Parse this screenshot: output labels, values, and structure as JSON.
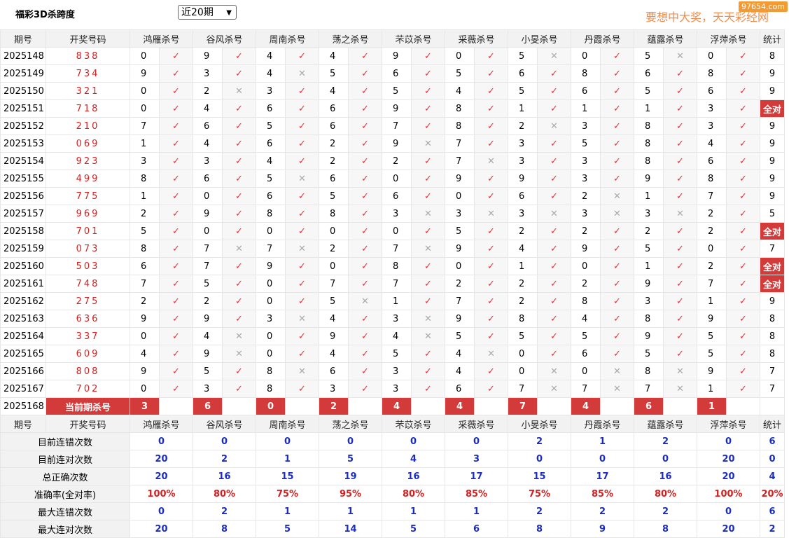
{
  "header": {
    "title": "福彩3D杀跨度",
    "period_select": "近20期",
    "slogan": "要想中大奖，天天彩经网",
    "watermark": "97654.com"
  },
  "columns": {
    "issue": "期号",
    "draw": "开奖号码",
    "experts": [
      "鸿雁杀号",
      "谷风杀号",
      "周南杀号",
      "荡之杀号",
      "芣苡杀号",
      "采薇杀号",
      "小旻杀号",
      "丹霞杀号",
      "蕴露杀号",
      "浮萍杀号"
    ],
    "stat": "统计"
  },
  "marks": {
    "ok": "✓",
    "no": "✕"
  },
  "rows": [
    {
      "issue": "2025148",
      "draw": "838",
      "picks": [
        [
          0,
          1
        ],
        [
          9,
          1
        ],
        [
          4,
          1
        ],
        [
          4,
          1
        ],
        [
          9,
          1
        ],
        [
          0,
          1
        ],
        [
          5,
          0
        ],
        [
          0,
          1
        ],
        [
          5,
          0
        ],
        [
          0,
          1
        ]
      ],
      "stat": "8"
    },
    {
      "issue": "2025149",
      "draw": "734",
      "picks": [
        [
          9,
          1
        ],
        [
          3,
          1
        ],
        [
          4,
          0
        ],
        [
          5,
          1
        ],
        [
          6,
          1
        ],
        [
          5,
          1
        ],
        [
          6,
          1
        ],
        [
          8,
          1
        ],
        [
          6,
          1
        ],
        [
          8,
          1
        ]
      ],
      "stat": "9"
    },
    {
      "issue": "2025150",
      "draw": "321",
      "picks": [
        [
          0,
          1
        ],
        [
          2,
          0
        ],
        [
          3,
          1
        ],
        [
          4,
          1
        ],
        [
          5,
          1
        ],
        [
          4,
          1
        ],
        [
          5,
          1
        ],
        [
          6,
          1
        ],
        [
          5,
          1
        ],
        [
          6,
          1
        ]
      ],
      "stat": "9"
    },
    {
      "issue": "2025151",
      "draw": "718",
      "picks": [
        [
          0,
          1
        ],
        [
          4,
          1
        ],
        [
          6,
          1
        ],
        [
          6,
          1
        ],
        [
          9,
          1
        ],
        [
          8,
          1
        ],
        [
          1,
          1
        ],
        [
          1,
          1
        ],
        [
          1,
          1
        ],
        [
          3,
          1
        ]
      ],
      "stat": "全对"
    },
    {
      "issue": "2025152",
      "draw": "210",
      "picks": [
        [
          7,
          1
        ],
        [
          6,
          1
        ],
        [
          5,
          1
        ],
        [
          6,
          1
        ],
        [
          7,
          1
        ],
        [
          8,
          1
        ],
        [
          2,
          0
        ],
        [
          3,
          1
        ],
        [
          8,
          1
        ],
        [
          3,
          1
        ]
      ],
      "stat": "9"
    },
    {
      "issue": "2025153",
      "draw": "069",
      "picks": [
        [
          1,
          1
        ],
        [
          4,
          1
        ],
        [
          6,
          1
        ],
        [
          2,
          1
        ],
        [
          9,
          0
        ],
        [
          7,
          1
        ],
        [
          3,
          1
        ],
        [
          5,
          1
        ],
        [
          8,
          1
        ],
        [
          4,
          1
        ]
      ],
      "stat": "9"
    },
    {
      "issue": "2025154",
      "draw": "923",
      "picks": [
        [
          3,
          1
        ],
        [
          3,
          1
        ],
        [
          4,
          1
        ],
        [
          2,
          1
        ],
        [
          2,
          1
        ],
        [
          7,
          0
        ],
        [
          3,
          1
        ],
        [
          3,
          1
        ],
        [
          8,
          1
        ],
        [
          6,
          1
        ]
      ],
      "stat": "9"
    },
    {
      "issue": "2025155",
      "draw": "499",
      "picks": [
        [
          8,
          1
        ],
        [
          6,
          1
        ],
        [
          5,
          0
        ],
        [
          6,
          1
        ],
        [
          0,
          1
        ],
        [
          9,
          1
        ],
        [
          9,
          1
        ],
        [
          3,
          1
        ],
        [
          9,
          1
        ],
        [
          8,
          1
        ]
      ],
      "stat": "9"
    },
    {
      "issue": "2025156",
      "draw": "775",
      "picks": [
        [
          1,
          1
        ],
        [
          0,
          1
        ],
        [
          6,
          1
        ],
        [
          5,
          1
        ],
        [
          6,
          1
        ],
        [
          0,
          1
        ],
        [
          6,
          1
        ],
        [
          2,
          0
        ],
        [
          1,
          1
        ],
        [
          7,
          1
        ]
      ],
      "stat": "9"
    },
    {
      "issue": "2025157",
      "draw": "969",
      "picks": [
        [
          2,
          1
        ],
        [
          9,
          1
        ],
        [
          8,
          1
        ],
        [
          8,
          1
        ],
        [
          3,
          0
        ],
        [
          3,
          0
        ],
        [
          3,
          0
        ],
        [
          3,
          0
        ],
        [
          3,
          0
        ],
        [
          2,
          1
        ]
      ],
      "stat": "5"
    },
    {
      "issue": "2025158",
      "draw": "701",
      "picks": [
        [
          5,
          1
        ],
        [
          0,
          1
        ],
        [
          0,
          1
        ],
        [
          0,
          1
        ],
        [
          0,
          1
        ],
        [
          5,
          1
        ],
        [
          2,
          1
        ],
        [
          2,
          1
        ],
        [
          2,
          1
        ],
        [
          2,
          1
        ]
      ],
      "stat": "全对"
    },
    {
      "issue": "2025159",
      "draw": "073",
      "picks": [
        [
          8,
          1
        ],
        [
          7,
          0
        ],
        [
          7,
          0
        ],
        [
          2,
          1
        ],
        [
          7,
          0
        ],
        [
          9,
          1
        ],
        [
          4,
          1
        ],
        [
          9,
          1
        ],
        [
          5,
          1
        ],
        [
          0,
          1
        ]
      ],
      "stat": "7"
    },
    {
      "issue": "2025160",
      "draw": "503",
      "picks": [
        [
          6,
          1
        ],
        [
          7,
          1
        ],
        [
          9,
          1
        ],
        [
          0,
          1
        ],
        [
          8,
          1
        ],
        [
          0,
          1
        ],
        [
          1,
          1
        ],
        [
          0,
          1
        ],
        [
          1,
          1
        ],
        [
          2,
          1
        ]
      ],
      "stat": "全对"
    },
    {
      "issue": "2025161",
      "draw": "748",
      "picks": [
        [
          7,
          1
        ],
        [
          5,
          1
        ],
        [
          0,
          1
        ],
        [
          7,
          1
        ],
        [
          7,
          1
        ],
        [
          2,
          1
        ],
        [
          2,
          1
        ],
        [
          2,
          1
        ],
        [
          9,
          1
        ],
        [
          7,
          1
        ]
      ],
      "stat": "全对"
    },
    {
      "issue": "2025162",
      "draw": "275",
      "picks": [
        [
          2,
          1
        ],
        [
          2,
          1
        ],
        [
          0,
          1
        ],
        [
          5,
          0
        ],
        [
          1,
          1
        ],
        [
          7,
          1
        ],
        [
          2,
          1
        ],
        [
          8,
          1
        ],
        [
          3,
          1
        ],
        [
          1,
          1
        ]
      ],
      "stat": "9"
    },
    {
      "issue": "2025163",
      "draw": "636",
      "picks": [
        [
          9,
          1
        ],
        [
          9,
          1
        ],
        [
          3,
          0
        ],
        [
          4,
          1
        ],
        [
          3,
          0
        ],
        [
          9,
          1
        ],
        [
          8,
          1
        ],
        [
          4,
          1
        ],
        [
          8,
          1
        ],
        [
          9,
          1
        ]
      ],
      "stat": "8"
    },
    {
      "issue": "2025164",
      "draw": "337",
      "picks": [
        [
          0,
          1
        ],
        [
          4,
          0
        ],
        [
          0,
          1
        ],
        [
          9,
          1
        ],
        [
          4,
          0
        ],
        [
          5,
          1
        ],
        [
          5,
          1
        ],
        [
          5,
          1
        ],
        [
          9,
          1
        ],
        [
          5,
          1
        ]
      ],
      "stat": "8"
    },
    {
      "issue": "2025165",
      "draw": "609",
      "picks": [
        [
          4,
          1
        ],
        [
          9,
          0
        ],
        [
          0,
          1
        ],
        [
          4,
          1
        ],
        [
          5,
          1
        ],
        [
          4,
          0
        ],
        [
          0,
          1
        ],
        [
          6,
          1
        ],
        [
          5,
          1
        ],
        [
          5,
          1
        ]
      ],
      "stat": "8"
    },
    {
      "issue": "2025166",
      "draw": "808",
      "picks": [
        [
          9,
          1
        ],
        [
          5,
          1
        ],
        [
          8,
          0
        ],
        [
          6,
          1
        ],
        [
          3,
          1
        ],
        [
          4,
          1
        ],
        [
          0,
          0
        ],
        [
          0,
          0
        ],
        [
          8,
          0
        ],
        [
          9,
          1
        ]
      ],
      "stat": "7"
    },
    {
      "issue": "2025167",
      "draw": "702",
      "picks": [
        [
          0,
          1
        ],
        [
          3,
          1
        ],
        [
          8,
          1
        ],
        [
          3,
          1
        ],
        [
          3,
          1
        ],
        [
          6,
          1
        ],
        [
          7,
          0
        ],
        [
          7,
          0
        ],
        [
          7,
          0
        ],
        [
          1,
          1
        ]
      ],
      "stat": "7"
    }
  ],
  "current": {
    "issue": "2025168",
    "label": "当前期杀号",
    "kills": [
      "3",
      "6",
      "0",
      "2",
      "4",
      "4",
      "7",
      "4",
      "6",
      "1"
    ]
  },
  "stats": {
    "rows": [
      {
        "label": "目前连错次数",
        "values": [
          "0",
          "0",
          "0",
          "0",
          "0",
          "0",
          "2",
          "1",
          "2",
          "0"
        ],
        "stat": "6",
        "style": "blue"
      },
      {
        "label": "目前连对次数",
        "values": [
          "20",
          "2",
          "1",
          "5",
          "4",
          "3",
          "0",
          "0",
          "0",
          "20"
        ],
        "stat": "0",
        "style": "blue"
      },
      {
        "label": "总正确次数",
        "values": [
          "20",
          "16",
          "15",
          "19",
          "16",
          "17",
          "15",
          "17",
          "16",
          "20"
        ],
        "stat": "4",
        "style": "blue"
      },
      {
        "label": "准确率(全对率)",
        "values": [
          "100%",
          "80%",
          "75%",
          "95%",
          "80%",
          "85%",
          "75%",
          "85%",
          "80%",
          "100%"
        ],
        "stat": "20%",
        "style": "red"
      },
      {
        "label": "最大连错次数",
        "values": [
          "0",
          "2",
          "1",
          "1",
          "1",
          "1",
          "2",
          "2",
          "2",
          "0"
        ],
        "stat": "6",
        "style": "blue"
      },
      {
        "label": "最大连对次数",
        "values": [
          "20",
          "8",
          "5",
          "14",
          "5",
          "6",
          "8",
          "9",
          "8",
          "20"
        ],
        "stat": "2",
        "style": "blue"
      }
    ]
  }
}
